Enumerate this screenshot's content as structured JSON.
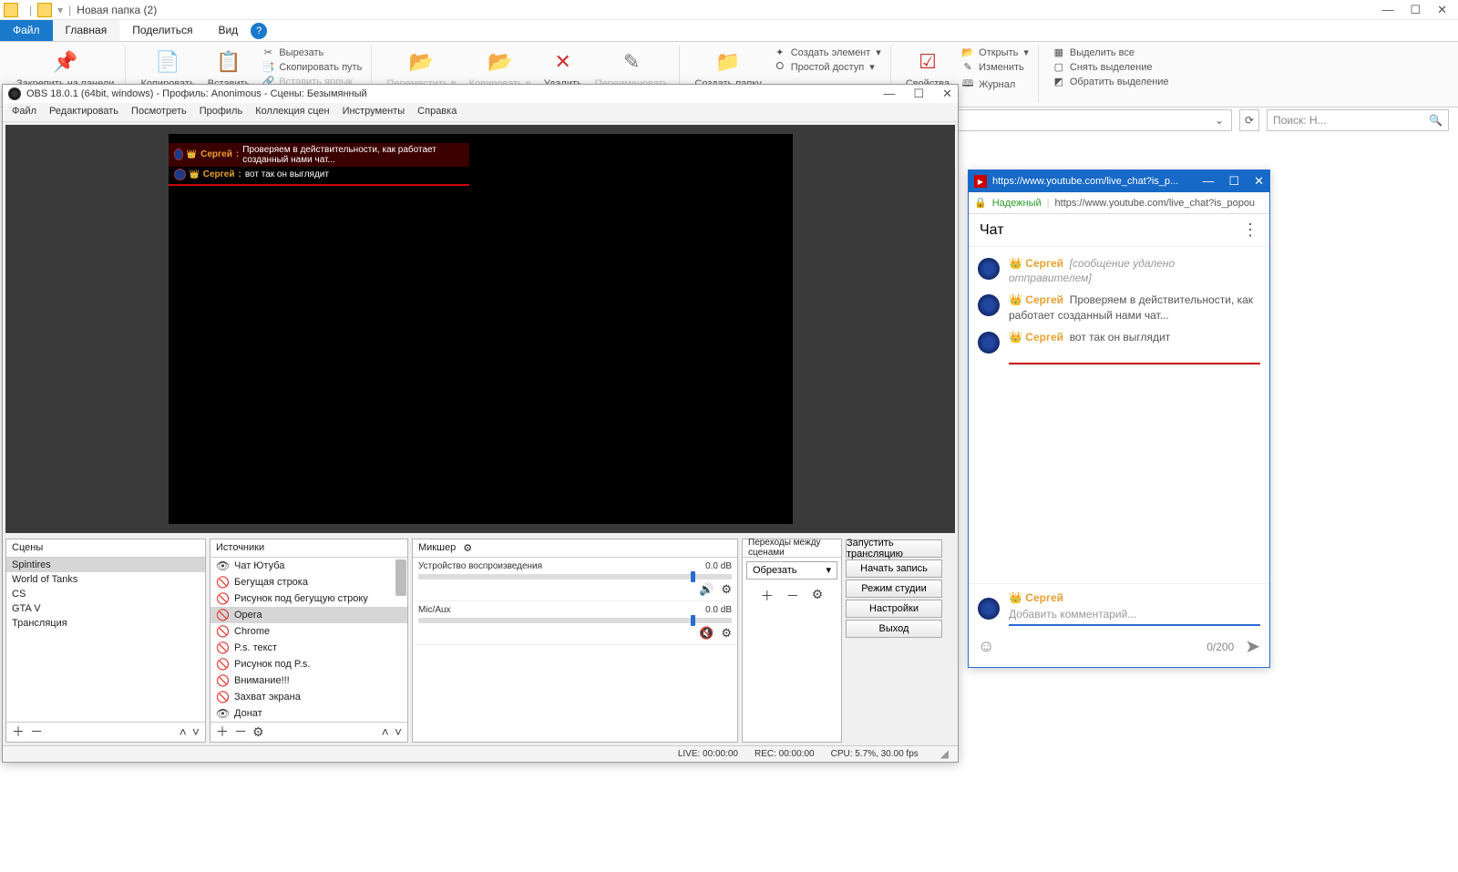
{
  "explorer": {
    "title": "Новая папка (2)",
    "tabs": {
      "file": "Файл",
      "home": "Главная",
      "share": "Поделиться",
      "view": "Вид"
    },
    "ribbon": {
      "pin": "Закрепить на панели",
      "copy": "Копировать",
      "paste": "Вставить",
      "cut": "Вырезать",
      "copypath": "Скопировать путь",
      "pastelink": "Вставить ярлык",
      "moveto": "Переместить в",
      "copyto": "Копировать в",
      "delete": "Удалить",
      "rename": "Переименовать",
      "newfolder": "Создать папку",
      "newitem": "Создать элемент",
      "easyaccess": "Простой доступ",
      "properties": "Свойства",
      "open": "Открыть",
      "edit": "Изменить",
      "history": "Журнал",
      "selectall": "Выделить все",
      "selectnone": "Снять выделение",
      "invert": "Обратить выделение"
    },
    "search_placeholder": "Поиск: Н..."
  },
  "obs": {
    "title": "OBS 18.0.1 (64bit, windows) - Профиль: Anonimous - Сцены: Безымянный",
    "menu": [
      "Файл",
      "Редактировать",
      "Посмотреть",
      "Профиль",
      "Коллекция сцен",
      "Инструменты",
      "Справка"
    ],
    "chat": [
      {
        "name": "Сергей",
        "msg": "Проверяем в действительности, как работает созданный нами чат..."
      },
      {
        "name": "Сергей",
        "msg": "вот так он выглядит"
      }
    ],
    "panels": {
      "scenes_hdr": "Сцены",
      "sources_hdr": "Источники",
      "mixer_hdr": "Микшер",
      "trans_hdr": "Переходы между сценами"
    },
    "scenes": [
      "Spintires",
      "World of Tanks",
      "CS",
      "GTA V",
      "Трансляция"
    ],
    "sources": [
      {
        "label": "Чат Ютуба",
        "visible": true
      },
      {
        "label": "Бегущая строка",
        "visible": false
      },
      {
        "label": "Рисунок под бегущую строку",
        "visible": false
      },
      {
        "label": "Opera",
        "visible": false,
        "selected": true
      },
      {
        "label": "Chrome",
        "visible": false
      },
      {
        "label": "P.s. текст",
        "visible": false
      },
      {
        "label": "Рисунок под P.s.",
        "visible": false
      },
      {
        "label": "Внимание!!!",
        "visible": false
      },
      {
        "label": "Захват экрана",
        "visible": false
      },
      {
        "label": "Донат",
        "visible": true
      }
    ],
    "mixer": {
      "ch1": {
        "name": "Устройство воспроизведения",
        "db": "0.0 dB"
      },
      "ch2": {
        "name": "Mic/Aux",
        "db": "0.0 dB"
      }
    },
    "trans_sel": "Обрезать",
    "controls": [
      "Запустить трансляцию",
      "Начать запись",
      "Режим студии",
      "Настройки",
      "Выход"
    ],
    "status": {
      "live": "LIVE: 00:00:00",
      "rec": "REC: 00:00:00",
      "cpu": "CPU: 5.7%, 30.00 fps"
    }
  },
  "youtube": {
    "title_url": "https://www.youtube.com/live_chat?is_p...",
    "secure_label": "Надежный",
    "addr_url": "https://www.youtube.com/live_chat?is_popou",
    "header": "Чат",
    "messages": [
      {
        "name": "Сергей",
        "deleted": "[сообщение удалено отправителем]"
      },
      {
        "name": "Сергей",
        "text": "Проверяем в действительности, как работает созданный нами чат..."
      },
      {
        "name": "Сергей",
        "text": "вот так он выглядит"
      }
    ],
    "user": "Сергей",
    "placeholder": "Добавить комментарий...",
    "counter": "0/200"
  }
}
